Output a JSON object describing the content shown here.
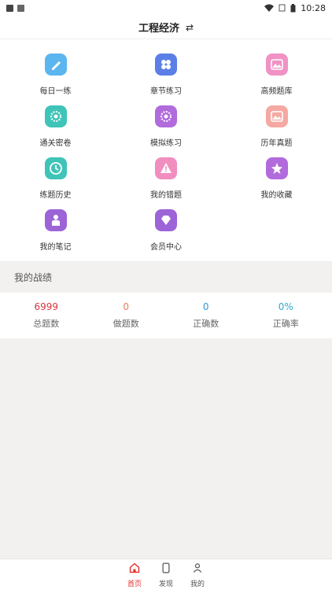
{
  "status_bar": {
    "time": "10:28"
  },
  "header": {
    "title": "工程经济",
    "swap_icon": "⇄"
  },
  "grid": [
    {
      "label": "每日一练",
      "icon": "pencil-icon",
      "color": "#5bb6f0"
    },
    {
      "label": "章节练习",
      "icon": "grid-icon",
      "color": "#5b7fe6"
    },
    {
      "label": "高频题库",
      "icon": "image-icon",
      "color": "#f092c4"
    },
    {
      "label": "通关密卷",
      "icon": "gear-icon",
      "color": "#3fc4b8"
    },
    {
      "label": "模拟练习",
      "icon": "gear-icon",
      "color": "#b16bdc"
    },
    {
      "label": "历年真题",
      "icon": "image-icon",
      "color": "#f4a9a2"
    },
    {
      "label": "练题历史",
      "icon": "clock-icon",
      "color": "#3fc4b8"
    },
    {
      "label": "我的错题",
      "icon": "warning-icon",
      "color": "#f18ec0"
    },
    {
      "label": "我的收藏",
      "icon": "star-icon",
      "color": "#b16bdc"
    },
    {
      "label": "我的笔记",
      "icon": "person-icon",
      "color": "#9d64d8"
    },
    {
      "label": "会员中心",
      "icon": "diamond-icon",
      "color": "#9d64d8"
    }
  ],
  "stats": {
    "title": "我的战绩",
    "items": [
      {
        "value": "6999",
        "label": "总题数",
        "color": "#d9343a"
      },
      {
        "value": "0",
        "label": "做题数",
        "color": "#ec7a5c"
      },
      {
        "value": "0",
        "label": "正确数",
        "color": "#2f9bd6"
      },
      {
        "value": "0%",
        "label": "正确率",
        "color": "#2fa9c8"
      }
    ]
  },
  "tabs": [
    {
      "label": "首页",
      "icon": "home-icon",
      "active": true
    },
    {
      "label": "发现",
      "icon": "phone-icon",
      "active": false
    },
    {
      "label": "我的",
      "icon": "person-icon",
      "active": false
    }
  ]
}
